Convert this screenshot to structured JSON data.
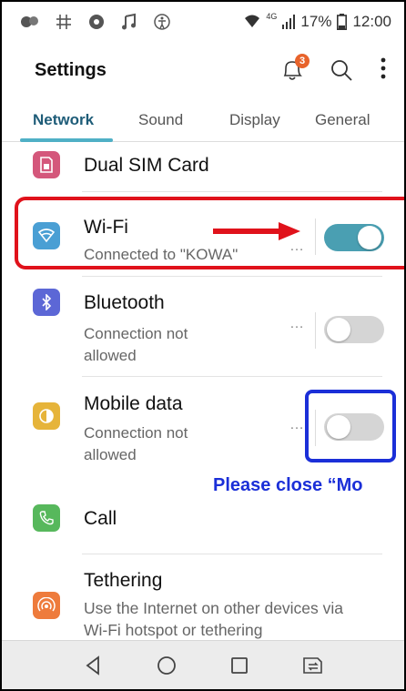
{
  "statusbar": {
    "left_icons": [
      "messenger-icon",
      "hashtag-grid-icon",
      "chat-icon",
      "music-icon",
      "accessibility-icon"
    ],
    "lte": "4G",
    "battery": "17%",
    "time": "12:00"
  },
  "header": {
    "title": "Settings",
    "notification_count": "3"
  },
  "tabs": [
    {
      "label": "Network"
    },
    {
      "label": "Sound"
    },
    {
      "label": "Display"
    },
    {
      "label": "General"
    }
  ],
  "items": {
    "dual_sim": {
      "name": "Dual SIM Card",
      "icon_color": "#d4577b"
    },
    "wifi": {
      "name": "Wi-Fi",
      "sub": "Connected to \"KOWA\"",
      "icon_color": "#4a9fd4",
      "toggle": true
    },
    "bluetooth": {
      "name": "Bluetooth",
      "sub_1": "Connection not",
      "sub_2": "allowed",
      "icon_color": "#5c67d6",
      "toggle": false
    },
    "mobile_data": {
      "name": "Mobile data",
      "sub_1": "Connection not",
      "sub_2": "allowed",
      "icon_color": "#e6b43a",
      "toggle": false
    },
    "call": {
      "name": "Call",
      "icon_color": "#57b85c"
    },
    "tethering": {
      "name": "Tethering",
      "sub_1": "Use the Internet on other devices via",
      "sub_2": "Wi-Fi hotspot or tethering",
      "icon_color": "#ee7b3c"
    }
  },
  "annotation": {
    "note": "Please close “Mo",
    "colors": {
      "red": "#e0121b",
      "blue": "#1b2fd8"
    }
  },
  "menu_dots": "…"
}
